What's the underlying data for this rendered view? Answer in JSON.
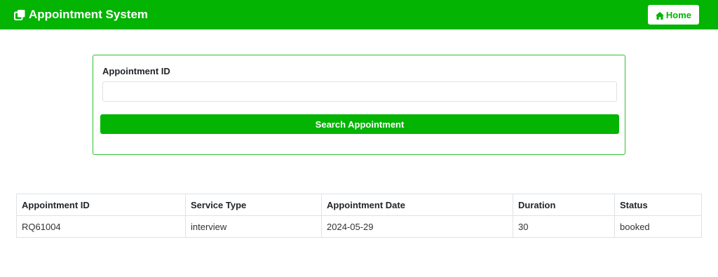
{
  "navbar": {
    "brand_icon": "clone-icon",
    "title": "Appointment System",
    "home_icon": "home-icon",
    "home_label": "Home",
    "color": "#03b403"
  },
  "search": {
    "label": "Appointment ID",
    "value": "",
    "placeholder": "",
    "button_label": "Search Appointment"
  },
  "table": {
    "headers": [
      "Appointment ID",
      "Service Type",
      "Appointment Date",
      "Duration",
      "Status"
    ],
    "rows": [
      [
        "RQ61004",
        "interview",
        "2024-05-29",
        "30",
        "booked"
      ]
    ]
  }
}
